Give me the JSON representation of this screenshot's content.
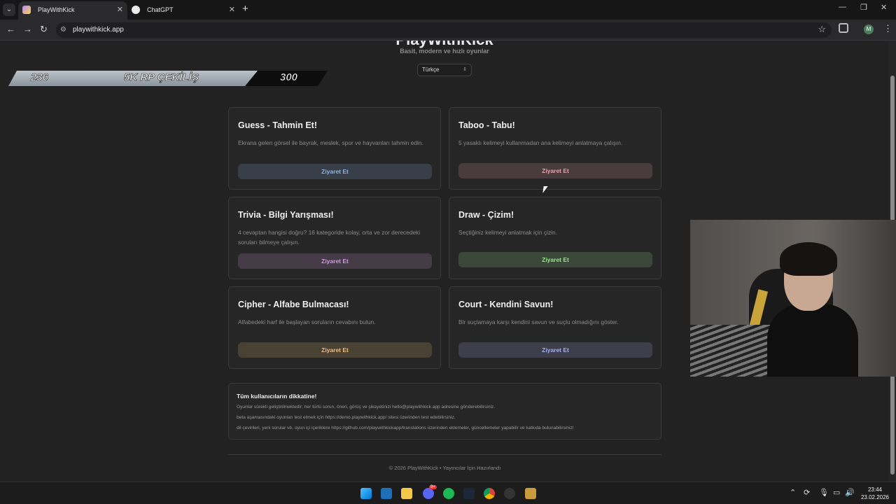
{
  "browser": {
    "tabs": [
      {
        "title": "PlayWithKick"
      },
      {
        "title": "ChatGPT"
      }
    ],
    "url": "playwithkick.app",
    "profile_initial": "M"
  },
  "page": {
    "title": "PlayWithKick",
    "subtitle": "Basit, modern ve hızlı oyunlar",
    "language": "Türkçe",
    "banner": {
      "left_number": "236",
      "title": "5K RP ÇEKİLİŞ",
      "right_number": "300"
    },
    "cards": [
      {
        "title": "Guess - Tahmin Et!",
        "description": "Ekrana gelen görsel ile bayrak, meslek, spor ve hayvanları tahmin edin.",
        "button": "Ziyaret Et",
        "color": "#8fb1e6"
      },
      {
        "title": "Taboo - Tabu!",
        "description": "5 yasaklı kelimeyi kullanmadan ana kelimeyi anlatmaya çalışın.",
        "button": "Ziyaret Et",
        "color": "#e7a0a6"
      },
      {
        "title": "Trivia - Bilgi Yarışması!",
        "description": "4 cevaptan hangisi doğru? 16 kategoride kolay, orta ve zor derecedeki soruları bilmeye çalışın.",
        "button": "Ziyaret Et",
        "color": "#d19be0"
      },
      {
        "title": "Draw - Çizim!",
        "description": "Seçtiğiniz kelimeyi anlatmak için çizin.",
        "button": "Ziyaret Et",
        "color": "#9be38f"
      },
      {
        "title": "Cipher - Alfabe Bulmacası!",
        "description": "Alfabedeki harf ile başlayan soruların cevabını bulun.",
        "button": "Ziyaret Et",
        "color": "#f0bd7c"
      },
      {
        "title": "Court - Kendini Savun!",
        "description": "Bir suçlamaya karşı kendini savun ve suçlu olmadığını göster.",
        "button": "Ziyaret Et",
        "color": "#a8aef0"
      }
    ],
    "notice": {
      "title": "Tüm kullanıcıların dikkatine!",
      "lines": [
        "Oyunlar sürekli geliştirilmektedir; her türlü sorun, öneri, görüş ve şikayetinizi hello@playwithkick.app adresine gönderebilirsiniz.",
        "beta aşamasındaki oyunları test etmek için https://demo.playwithkick.app/ sitesi üzerinden test edebilirsiniz.",
        "dil çevirileri, yeni sorular vb. oyun içi içeriklere https://github.com/playwithkickapp/translations üzerinden eklemeler, güncellemeler yapabilir ve katkıda bulunabilirsiniz!"
      ]
    },
    "footer": "© 2026 PlayWithKick • Yayıncılar İçin Hazırlandı"
  },
  "taskbar": {
    "time": "23:44",
    "date": "23.02.2026",
    "discord_badge": "9+"
  }
}
